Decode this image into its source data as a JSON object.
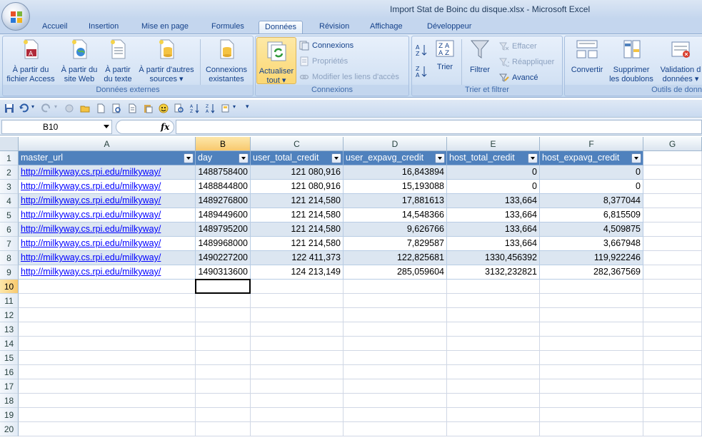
{
  "window": {
    "title": "Import Stat de Boinc du disque.xlsx - Microsoft Excel"
  },
  "tabs": [
    "Accueil",
    "Insertion",
    "Mise en page",
    "Formules",
    "Données",
    "Révision",
    "Affichage",
    "Développeur"
  ],
  "active_tab": "Données",
  "ribbon": {
    "groups": {
      "external": "Données externes",
      "connections": "Connexions",
      "sort_filter": "Trier et filtrer",
      "tools": "Outils de donn"
    },
    "buttons": {
      "access": [
        "À partir du",
        "fichier Access"
      ],
      "web": [
        "À partir du",
        "site Web"
      ],
      "text": [
        "À partir",
        "du texte"
      ],
      "other": [
        "À partir d'autres",
        "sources ▾"
      ],
      "existing": [
        "Connexions",
        "existantes"
      ],
      "refresh": [
        "Actualiser",
        "tout ▾"
      ],
      "connections": "Connexions",
      "properties": "Propriétés",
      "edit_links": "Modifier les liens d'accès",
      "sort": "Trier",
      "filter": "Filtrer",
      "clear": "Effacer",
      "reapply": "Réappliquer",
      "advanced": "Avancé",
      "convert": "Convertir",
      "remove_dup": [
        "Supprimer",
        "les doublons"
      ],
      "validation": [
        "Validation d",
        "données ▾"
      ]
    }
  },
  "formula_bar": {
    "name_box": "B10",
    "fx": "fx",
    "formula": ""
  },
  "columns": [
    "A",
    "B",
    "C",
    "D",
    "E",
    "F",
    "G"
  ],
  "selected_column": "B",
  "selected_row": 10,
  "rows": [
    "1",
    "2",
    "3",
    "4",
    "5",
    "6",
    "7",
    "8",
    "9",
    "10",
    "11",
    "12",
    "13",
    "14",
    "15",
    "16",
    "17",
    "18",
    "19",
    "20"
  ],
  "table": {
    "headers": [
      "master_url",
      "day",
      "user_total_credit",
      "user_expavg_credit",
      "host_total_credit",
      "host_expavg_credit"
    ],
    "data": [
      [
        "http://milkyway.cs.rpi.edu/milkyway/",
        "1488758400",
        "121 080,916",
        "16,843894",
        "0",
        "0"
      ],
      [
        "http://milkyway.cs.rpi.edu/milkyway/",
        "1488844800",
        "121 080,916",
        "15,193088",
        "0",
        "0"
      ],
      [
        "http://milkyway.cs.rpi.edu/milkyway/",
        "1489276800",
        "121 214,580",
        "17,881613",
        "133,664",
        "8,377044"
      ],
      [
        "http://milkyway.cs.rpi.edu/milkyway/",
        "1489449600",
        "121 214,580",
        "14,548366",
        "133,664",
        "6,815509"
      ],
      [
        "http://milkyway.cs.rpi.edu/milkyway/",
        "1489795200",
        "121 214,580",
        "9,626766",
        "133,664",
        "4,509875"
      ],
      [
        "http://milkyway.cs.rpi.edu/milkyway/",
        "1489968000",
        "121 214,580",
        "7,829587",
        "133,664",
        "3,667948"
      ],
      [
        "http://milkyway.cs.rpi.edu/milkyway/",
        "1490227200",
        "122 411,373",
        "122,825681",
        "1330,456392",
        "119,922246"
      ],
      [
        "http://milkyway.cs.rpi.edu/milkyway/",
        "1490313600",
        "124 213,149",
        "285,059604",
        "3132,232821",
        "282,367569"
      ]
    ]
  },
  "colors": {
    "header_bg": "#4f81bd",
    "band": "#dce6f1",
    "selected": "#f8c96e",
    "link": "#0000ff"
  }
}
